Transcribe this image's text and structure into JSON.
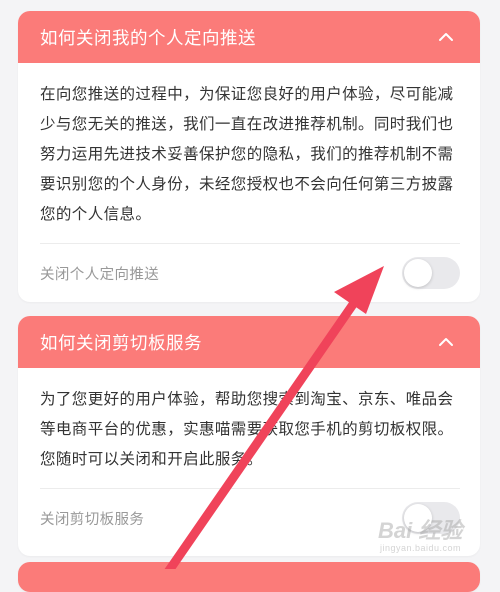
{
  "cards": [
    {
      "title": "如何关闭我的个人定向推送",
      "description": "在向您推送的过程中，为保证您良好的用户体验，尽可能减少与您无关的推送，我们一直在改进推荐机制。同时我们也努力运用先进技术妥善保护您的隐私，我们的推荐机制不需要识别您的个人身份，未经您授权也不会向任何第三方披露您的个人信息。",
      "toggle_label": "关闭个人定向推送",
      "toggle_on": false,
      "expanded": true
    },
    {
      "title": "如何关闭剪切板服务",
      "description": "为了您更好的用户体验，帮助您搜索到淘宝、京东、唯品会等电商平台的优惠，实惠喵需要获取您手机的剪切板权限。您随时可以关闭和开启此服务。",
      "toggle_label": "关闭剪切板服务",
      "toggle_on": false,
      "expanded": true
    }
  ],
  "colors": {
    "header": "#fb7b79",
    "arrow": "#f0435a",
    "background": "#f4f4f6"
  },
  "icons": {
    "expand": "chevron-up-icon"
  },
  "watermark": {
    "main": "Bai 经验",
    "sub": "jingyan.baidu.com"
  }
}
